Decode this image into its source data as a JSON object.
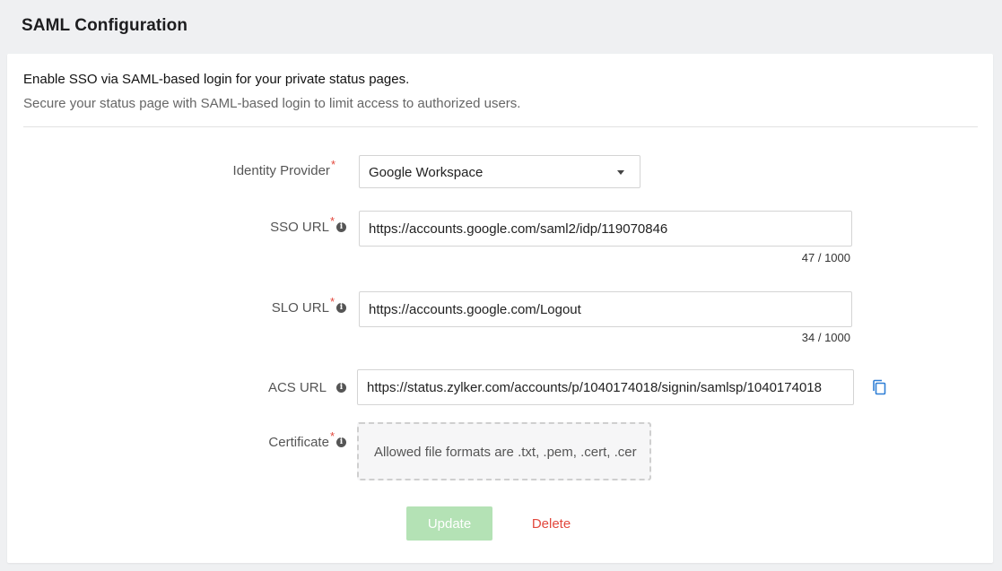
{
  "page": {
    "title": "SAML Configuration"
  },
  "intro": {
    "heading": "Enable SSO via SAML-based login for your private status pages.",
    "subheading": "Secure your status page with SAML-based login to limit access to authorized users."
  },
  "form": {
    "identity_provider": {
      "label": "Identity Provider",
      "required_marker": "*",
      "value": "Google Workspace"
    },
    "sso_url": {
      "label": "SSO URL",
      "required_marker": "*",
      "info_icon": "i",
      "value": "https://accounts.google.com/saml2/idp/119070846",
      "counter": "47 / 1000"
    },
    "slo_url": {
      "label": "SLO URL",
      "required_marker": "*",
      "info_icon": "i",
      "value": "https://accounts.google.com/Logout",
      "counter": "34 / 1000"
    },
    "acs_url": {
      "label": "ACS URL",
      "info_icon": "i",
      "value": "https://status.zylker.com/accounts/p/1040174018/signin/samlsp/1040174018"
    },
    "certificate": {
      "label": "Certificate",
      "required_marker": "*",
      "info_icon": "i",
      "dropzone_text": "Allowed file formats are .txt, .pem, .cert, .cer"
    }
  },
  "actions": {
    "update_label": "Update",
    "delete_label": "Delete"
  },
  "colors": {
    "required": "#e2483d",
    "update_button_disabled": "#b4e2b5",
    "delete": "#e2483d",
    "copy_icon": "#2f7fd6"
  },
  "icons": {
    "select_caret": "chevron-down-icon",
    "info": "info-icon",
    "copy": "copy-icon"
  }
}
